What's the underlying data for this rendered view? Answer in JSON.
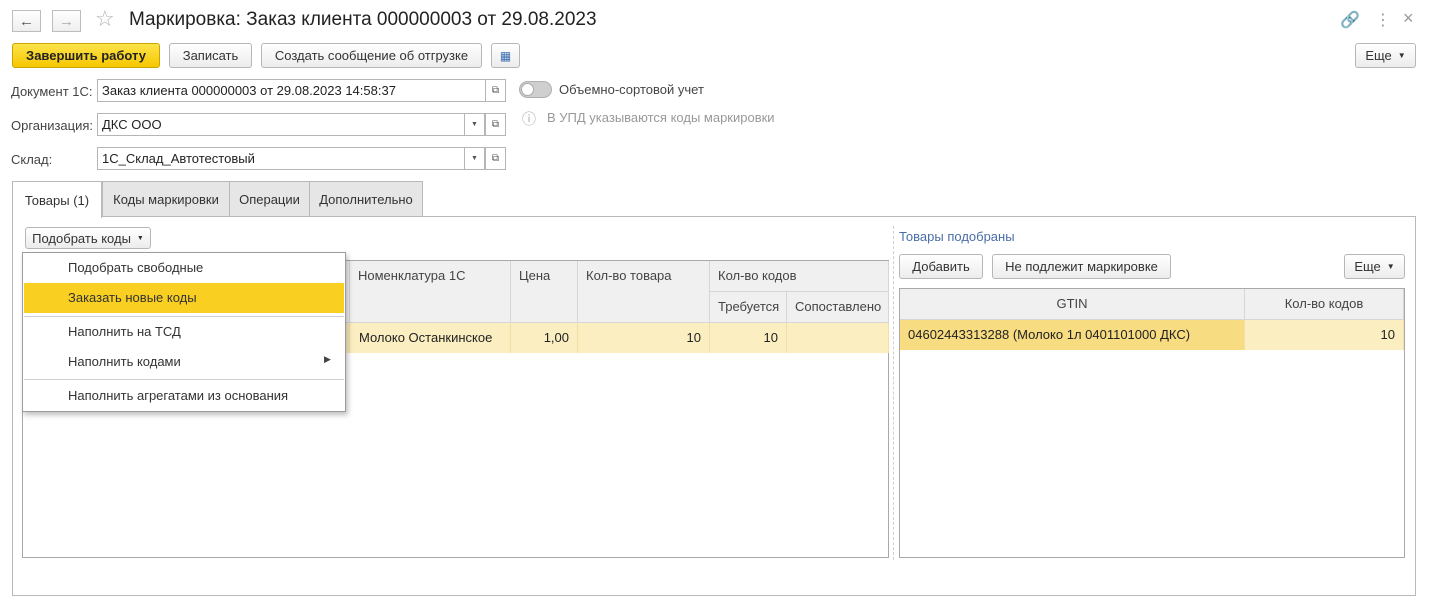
{
  "window": {
    "title": "Маркировка: Заказ клиента 000000003 от 29.08.2023"
  },
  "toolbar": {
    "finish": "Завершить работу",
    "save": "Записать",
    "create_shipment": "Создать сообщение об отгрузке",
    "more": "Еще"
  },
  "fields": {
    "document_label": "Документ 1С:",
    "document_value": "Заказ клиента 000000003 от 29.08.2023 14:58:37",
    "org_label": "Организация:",
    "org_value": "ДКС ООО",
    "warehouse_label": "Склад:",
    "warehouse_value": "1С_Склад_Автотестовый",
    "bulk_toggle_label": "Объемно-сортовой учет",
    "upd_note": "В УПД указываются коды маркировки"
  },
  "tabs": [
    "Товары (1)",
    "Коды маркировки",
    "Операции",
    "Дополнительно"
  ],
  "left": {
    "pick_codes_button": "Подобрать коды",
    "columns": {
      "nomenclature": "Номенклатура 1С",
      "price": "Цена",
      "qty": "Кол-во товара",
      "codes": "Кол-во кодов",
      "required": "Требуется",
      "matched": "Сопоставлено"
    },
    "rows": [
      {
        "nomenclature": "Молоко Останкинское",
        "price": "1,00",
        "qty": "10",
        "required": "10",
        "matched": ""
      }
    ]
  },
  "menu": {
    "items": [
      "Подобрать свободные",
      "Заказать новые коды",
      "Наполнить на ТСД",
      "Наполнить кодами",
      "Наполнить агрегатами из основания"
    ]
  },
  "right": {
    "heading": "Товары подобраны",
    "add": "Добавить",
    "not_marked": "Не подлежит маркировке",
    "more": "Еще",
    "columns": {
      "gtin": "GTIN",
      "codes": "Кол-во кодов"
    },
    "rows": [
      {
        "gtin": "04602443313288 (Молоко 1л 0401101000 ДКС)",
        "codes": "10"
      }
    ]
  }
}
